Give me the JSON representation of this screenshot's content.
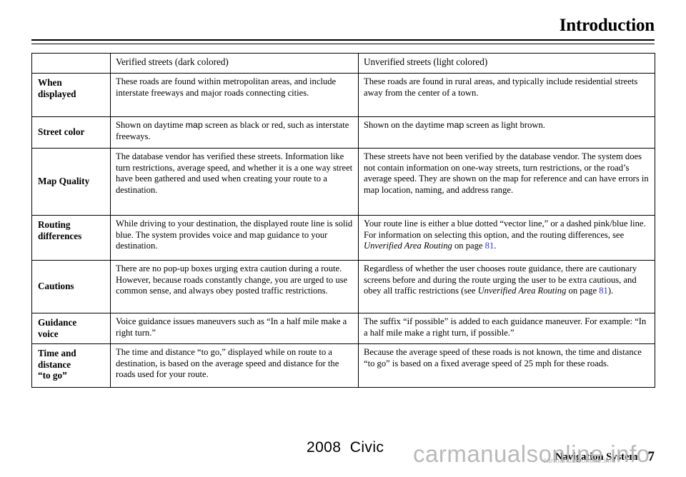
{
  "header": {
    "title": "Introduction"
  },
  "table": {
    "columns": {
      "corner": "",
      "verified": "Verified streets (dark colored)",
      "unverified": "Unverified streets (light colored)"
    },
    "rows": [
      {
        "label": "When\ndisplayed",
        "label_line1": "When",
        "label_line2": "displayed",
        "verified": "These roads are found within metropolitan areas, and include interstate freeways and major roads connecting cities.",
        "unverified": "These roads are found in rural areas, and typically include residential streets away from the center of a town."
      },
      {
        "label": "Street color",
        "verified_part1": "Shown on daytime ",
        "verified_map": "map",
        "verified_part2": " screen as black or red, such as interstate freeways.",
        "unverified_part1": "Shown on the daytime ",
        "unverified_map": "map",
        "unverified_part2": " screen as light brown."
      },
      {
        "label": "Map Quality",
        "verified": "The database vendor has verified these streets. Information like turn restrictions, average speed, and whether it is a one way street have been gathered and used when creating your route to a destination.",
        "unverified": "These streets have not been verified by the database vendor. The system does not contain information on one-way streets, turn restrictions, or the road’s average speed. They are shown on the map for reference and can have errors in map location, naming, and address range."
      },
      {
        "label_line1": "Routing",
        "label_line2": "differences",
        "verified": "While driving to your destination, the displayed route line is solid blue. The system provides voice and map guidance to your destination.",
        "unverified_part1": "Your route line is either a blue dotted “vector line,” or a dashed pink/blue line. For information on selecting this option, and the routing differences, see ",
        "unverified_italic": "Unverified Area Routing",
        "unverified_part2": " on page ",
        "unverified_page": "81",
        "unverified_part3": "."
      },
      {
        "label": "Cautions",
        "verified": "There are no pop-up boxes urging extra caution during a route. However, because roads constantly change, you are urged to use common sense, and always obey posted traffic restrictions.",
        "unverified_part1": "Regardless of whether the user chooses route guidance, there are cautionary screens before and during the route urging the user to be extra cautious, and obey all traffic restrictions (see ",
        "unverified_italic": "Unverified Area Routing",
        "unverified_part2": " on page ",
        "unverified_page": "81",
        "unverified_part3": ")."
      },
      {
        "label_line1": "Guidance",
        "label_line2": "voice",
        "verified": "Voice guidance issues maneuvers such as “In a half mile make a right turn.”",
        "unverified": "The suffix “if possible” is added to each guidance maneuver. For example: “In a half mile make a right turn, if possible.”"
      },
      {
        "label_line1": "Time and",
        "label_line2": "distance",
        "label_line3": "“to go”",
        "verified": "The time and distance “to go,” displayed while on route to a destination, is based on the average speed and distance for the roads used for your route.",
        "unverified": "Because the average speed of these roads is not known, the time and distance “to go” is based on a fixed average speed of 25 mph for these roads."
      }
    ]
  },
  "footer": {
    "model": "2008  Civic",
    "section": "Navigation System",
    "page": "7"
  },
  "watermark": {
    "big": "carmanualsonline.info",
    "small": "carmanualsonline.info"
  },
  "colors": {
    "text": "#000000",
    "link": "#2c36d6",
    "rule": "#000000",
    "watermark": "#b9b9b9"
  }
}
